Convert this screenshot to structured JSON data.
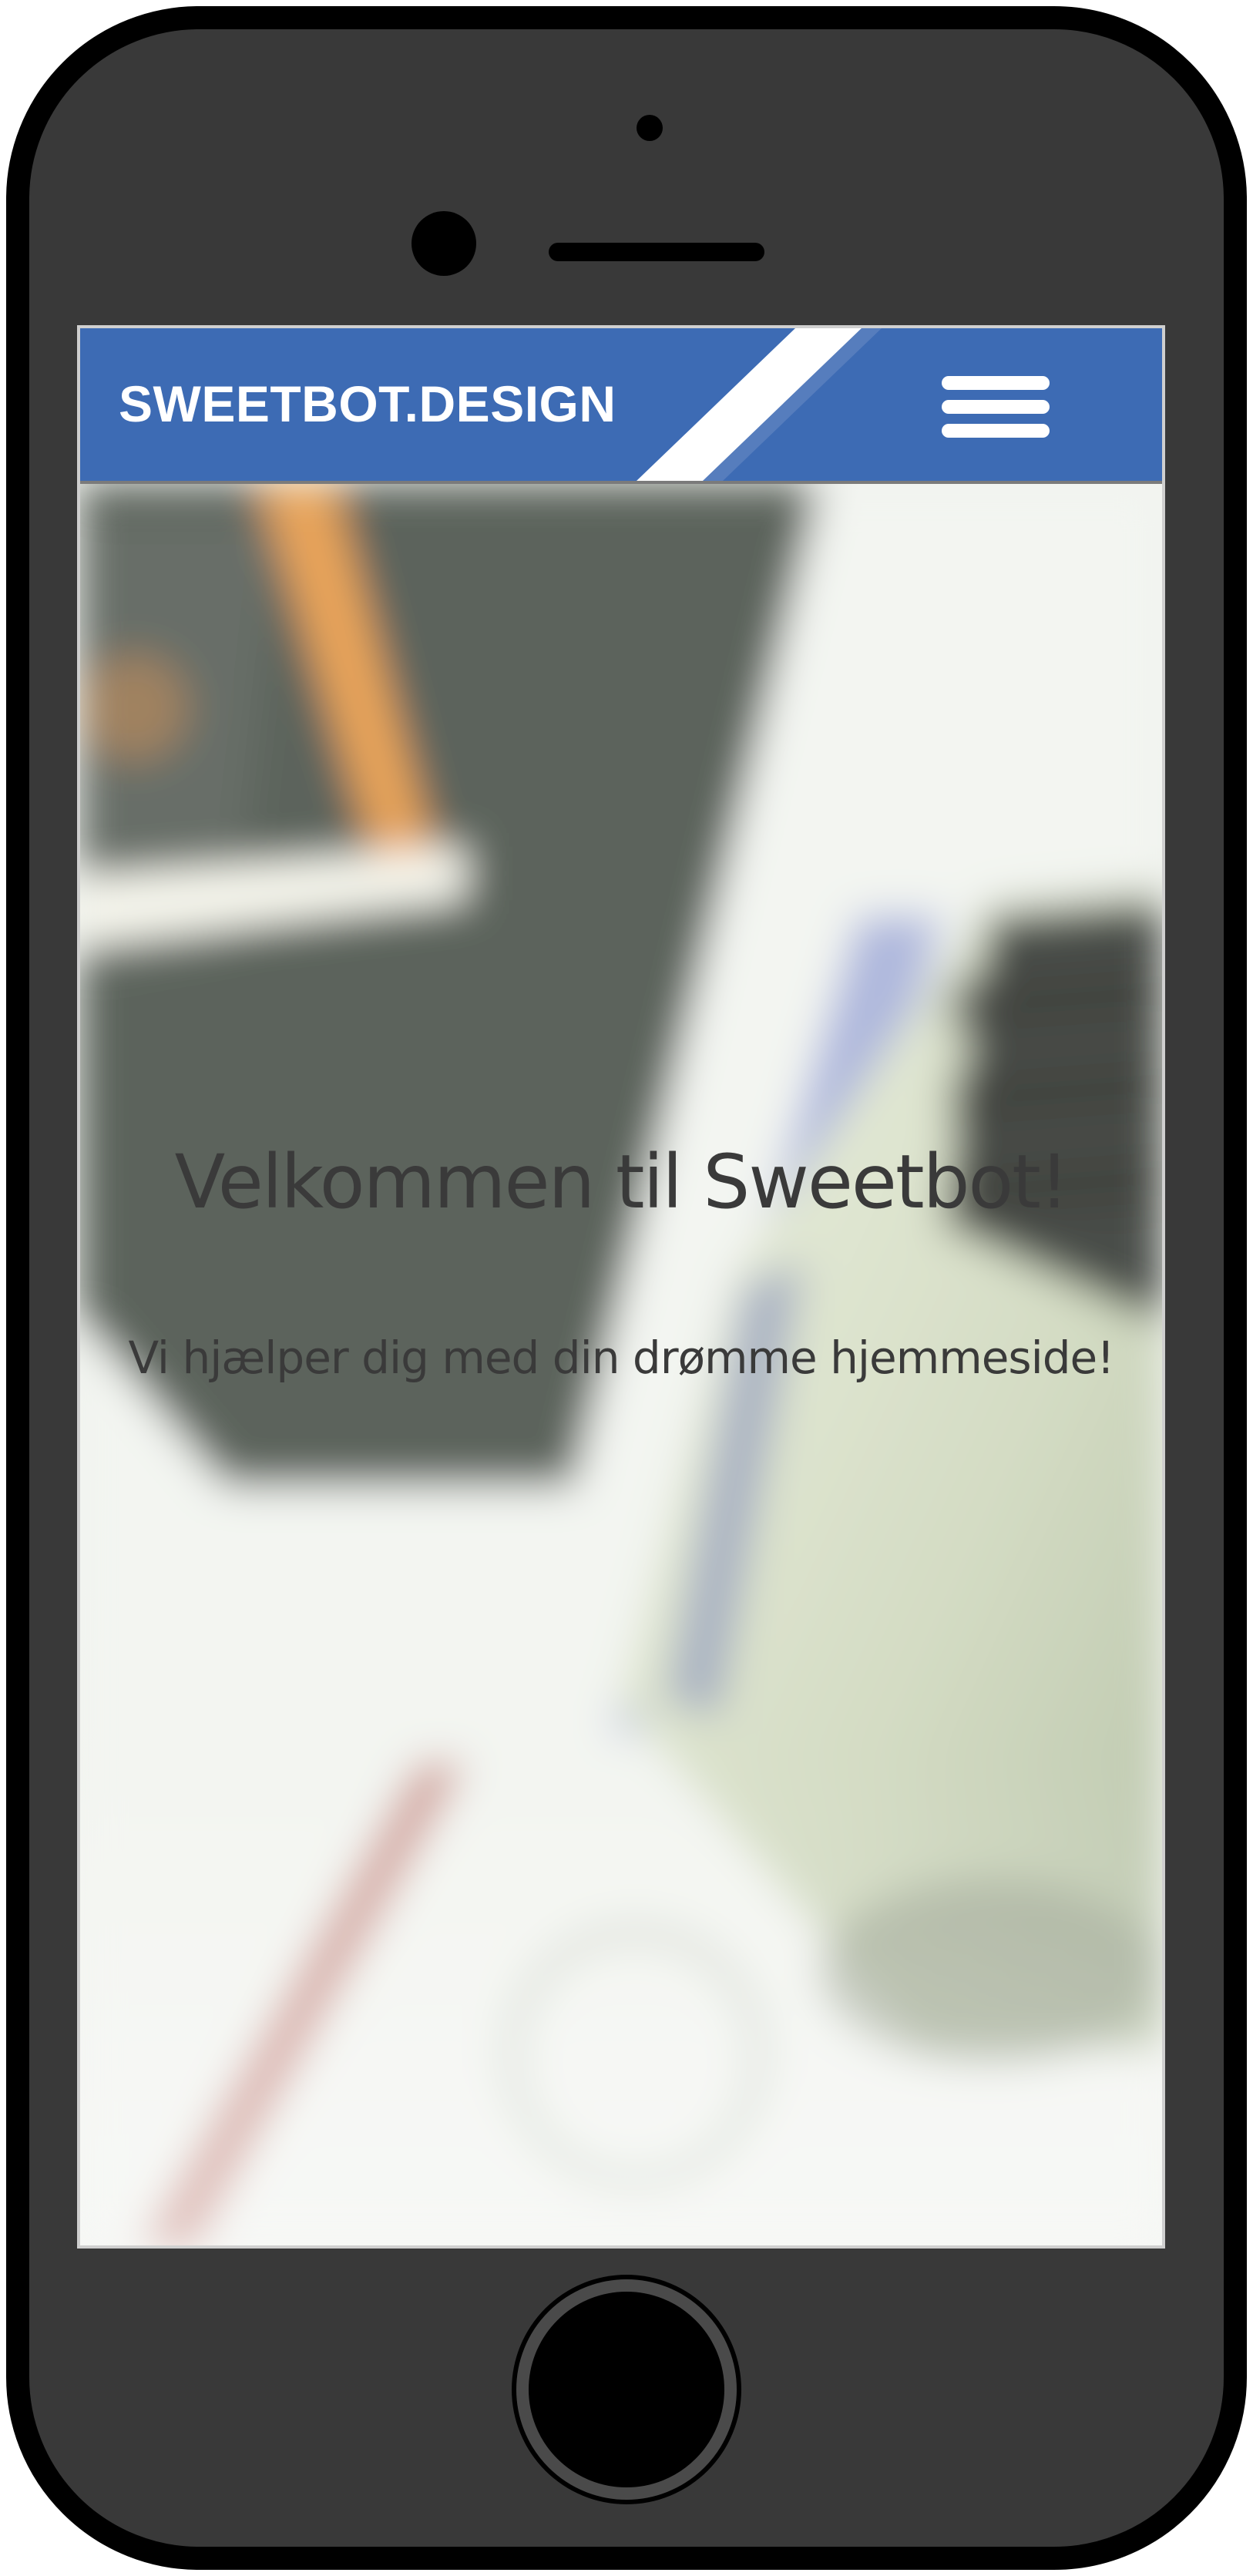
{
  "site": {
    "brand": "SWEETBOT.DESIGN",
    "brand_color": "#3d6bb4"
  },
  "navbar": {
    "menu_icon": "hamburger-menu-icon"
  },
  "hero": {
    "headline": "Velkommen til Sweetbot!",
    "subline": "Vi hjælper dig med din drømme hjemmeside!",
    "text_color": "#3a3a3a"
  },
  "device": {
    "frame_color": "#393939",
    "home_button_icon": "home-button"
  }
}
